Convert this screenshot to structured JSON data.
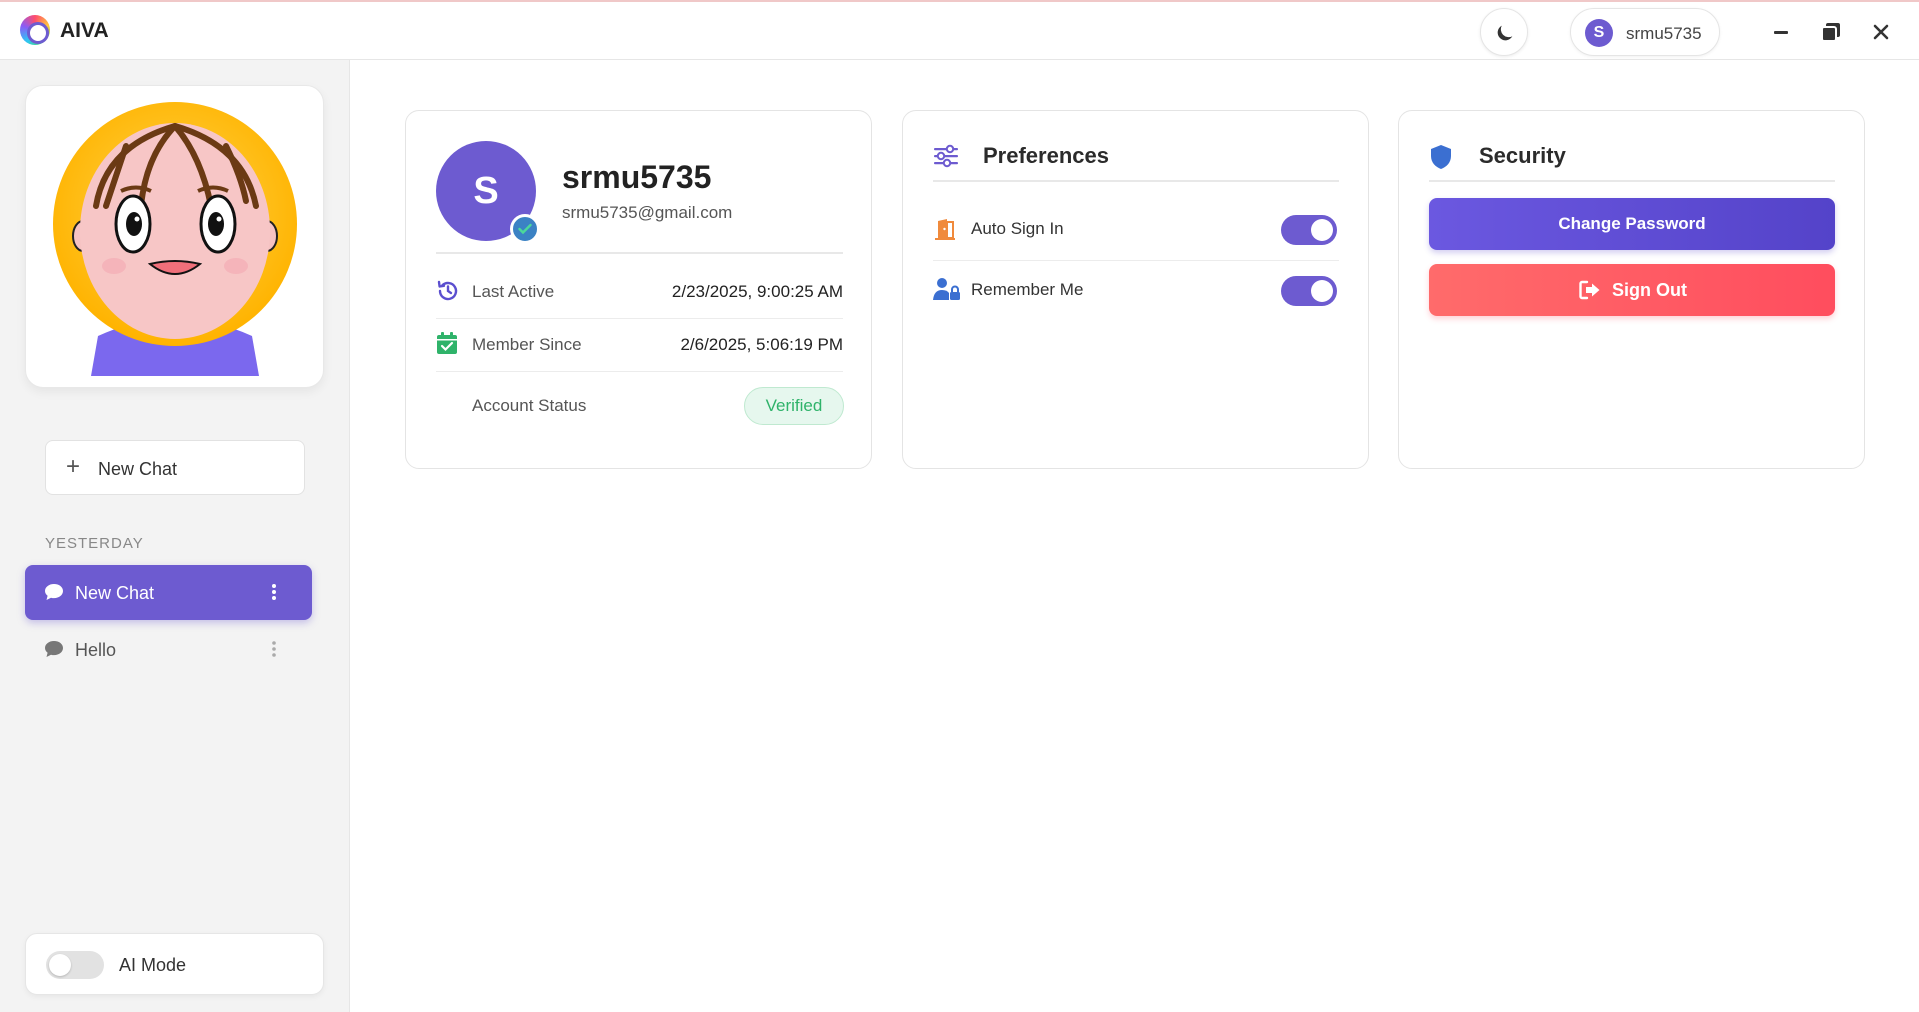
{
  "app": {
    "name": "AIVA"
  },
  "header": {
    "theme_icon": "moon-icon",
    "user_initial": "S",
    "username": "srmu5735",
    "window_controls": [
      "minimize-icon",
      "restore-icon",
      "close-icon"
    ]
  },
  "sidebar": {
    "new_chat_label": "New Chat",
    "section_label": "YESTERDAY",
    "chats": [
      {
        "label": "New Chat",
        "active": true
      },
      {
        "label": "Hello",
        "active": false
      }
    ],
    "ai_mode": {
      "label": "AI Mode",
      "enabled": false
    }
  },
  "profile": {
    "initial": "S",
    "username": "srmu5735",
    "email": "srmu5735@gmail.com",
    "rows": [
      {
        "label": "Last Active",
        "value": "2/23/2025, 9:00:25 AM",
        "icon": "history-icon"
      },
      {
        "label": "Member Since",
        "value": "2/6/2025, 5:06:19 PM",
        "icon": "calendar-check-icon"
      },
      {
        "label": "Account Status",
        "value": "Verified"
      }
    ]
  },
  "preferences": {
    "title": "Preferences",
    "items": [
      {
        "label": "Auto Sign In",
        "enabled": true,
        "icon": "door-icon"
      },
      {
        "label": "Remember Me",
        "enabled": true,
        "icon": "user-lock-icon"
      }
    ]
  },
  "security": {
    "title": "Security",
    "change_password_label": "Change Password",
    "sign_out_label": "Sign Out"
  },
  "colors": {
    "accent": "#6d5bd0",
    "danger": "#ff5a64",
    "success": "#2fb36a",
    "sidebar_bg": "#f3f3f3"
  }
}
